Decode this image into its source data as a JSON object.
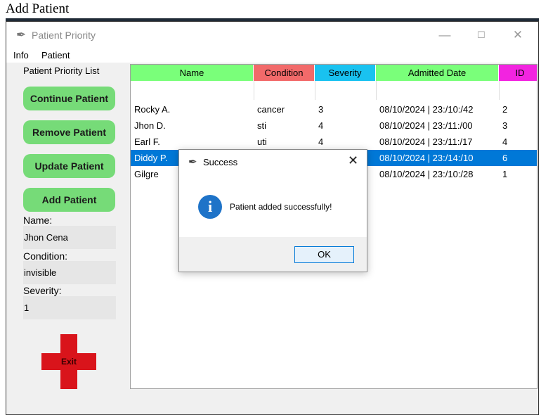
{
  "caption": "Add Patient",
  "window": {
    "title": "Patient Priority",
    "controls": {
      "minimize": "—",
      "maximize": "☐",
      "close": "✕"
    }
  },
  "menu": {
    "items": [
      "Info",
      "Patient"
    ]
  },
  "sidebar": {
    "title": "Patient Priority List",
    "buttons": [
      "Continue Patient",
      "Remove Patient",
      "Update Patient",
      "Add Patient"
    ],
    "fields": [
      {
        "label": "Name:",
        "value": "Jhon Cena"
      },
      {
        "label": "Condition:",
        "value": "invisible"
      },
      {
        "label": "Severity:",
        "value": "1"
      }
    ],
    "exit_label": "Exit"
  },
  "table": {
    "headers": [
      {
        "label": "Name",
        "color": "#7aff7a"
      },
      {
        "label": "Condition",
        "color": "#f26a6a"
      },
      {
        "label": "Severity",
        "color": "#19c2f0"
      },
      {
        "label": "Admitted Date",
        "color": "#7aff7a"
      },
      {
        "label": "ID",
        "color": "#f224e0"
      }
    ],
    "rows": [
      {
        "name": "Rocky A.",
        "condition": "cancer",
        "severity": "3",
        "date": "08/10/2024 | 23:/10:/42",
        "id": "2",
        "selected": false
      },
      {
        "name": "Jhon D.",
        "condition": "sti",
        "severity": "4",
        "date": "08/10/2024 | 23:/11:/00",
        "id": "3",
        "selected": false
      },
      {
        "name": "Earl F.",
        "condition": "uti",
        "severity": "4",
        "date": "08/10/2024 | 23:/11:/17",
        "id": "4",
        "selected": false
      },
      {
        "name": "Diddy P.",
        "condition": "",
        "severity": "",
        "date": "08/10/2024 | 23:/14:/10",
        "id": "6",
        "selected": true
      },
      {
        "name": "Gilgre",
        "condition": "",
        "severity": "",
        "date": "08/10/2024 | 23:/10:/28",
        "id": "1",
        "selected": false
      }
    ]
  },
  "dialog": {
    "title": "Success",
    "message": "Patient added successfully!",
    "ok_label": "OK",
    "close_glyph": "✕",
    "icon_glyph": "i"
  },
  "colors": {
    "button_green": "#76db78",
    "selection": "#0078d7",
    "exit_red": "#d9141b"
  }
}
